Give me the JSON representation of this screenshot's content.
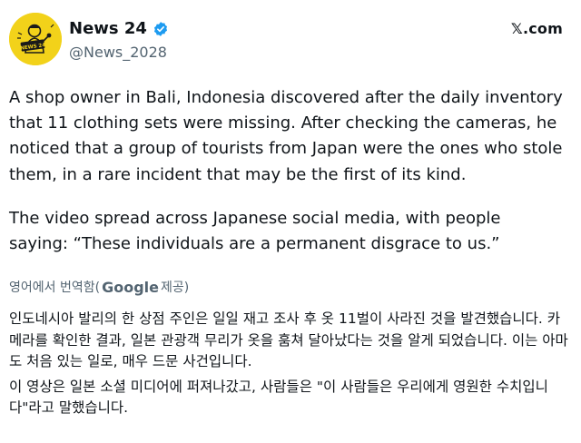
{
  "account": {
    "display_name": "News 24",
    "handle": "@News_2028",
    "avatar_text": "NEWS 24",
    "verified": true
  },
  "source": {
    "label": "𝕏.com"
  },
  "post": {
    "paragraph_1": "A shop owner in Bali, Indonesia discovered after the daily inventory that 11 clothing sets were missing. After checking the cameras, he noticed that a group of tourists from Japan were the ones who stole them, in a rare incident that may be the first of its kind.",
    "paragraph_2": "The video spread across Japanese social media, with people saying: “These individuals are a permanent disgrace to us.”"
  },
  "translation": {
    "prefix": "영어에서 번역함(",
    "brand": "Google",
    "suffix": " 제공)",
    "paragraph_1": "인도네시아 발리의 한 상점 주인은 일일 재고 조사 후 옷 11벌이 사라진 것을 발견했습니다. 카메라를 확인한 결과, 일본 관광객 무리가 옷을 훔쳐 달아났다는 것을 알게 되었습니다. 이는 아마도 처음 있는 일로, 매우 드문 사건입니다.",
    "paragraph_2": "이 영상은 일본 소셜 미디어에 퍼져나갔고, 사람들은 \"이 사람들은 우리에게 영원한 수치입니다\"라고 말했습니다."
  },
  "colors": {
    "verified_badge": "#1d9bf0",
    "avatar_bg": "#f2d21a",
    "secondary_text": "#536471"
  }
}
